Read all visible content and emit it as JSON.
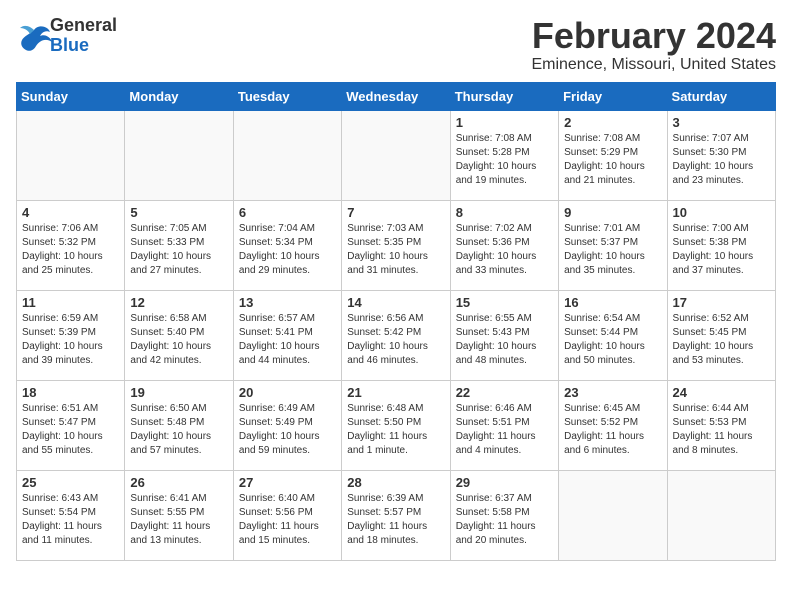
{
  "header": {
    "logo_general": "General",
    "logo_blue": "Blue",
    "month_title": "February 2024",
    "location": "Eminence, Missouri, United States"
  },
  "days_of_week": [
    "Sunday",
    "Monday",
    "Tuesday",
    "Wednesday",
    "Thursday",
    "Friday",
    "Saturday"
  ],
  "weeks": [
    [
      {
        "day": "",
        "info": ""
      },
      {
        "day": "",
        "info": ""
      },
      {
        "day": "",
        "info": ""
      },
      {
        "day": "",
        "info": ""
      },
      {
        "day": "1",
        "info": "Sunrise: 7:08 AM\nSunset: 5:28 PM\nDaylight: 10 hours\nand 19 minutes."
      },
      {
        "day": "2",
        "info": "Sunrise: 7:08 AM\nSunset: 5:29 PM\nDaylight: 10 hours\nand 21 minutes."
      },
      {
        "day": "3",
        "info": "Sunrise: 7:07 AM\nSunset: 5:30 PM\nDaylight: 10 hours\nand 23 minutes."
      }
    ],
    [
      {
        "day": "4",
        "info": "Sunrise: 7:06 AM\nSunset: 5:32 PM\nDaylight: 10 hours\nand 25 minutes."
      },
      {
        "day": "5",
        "info": "Sunrise: 7:05 AM\nSunset: 5:33 PM\nDaylight: 10 hours\nand 27 minutes."
      },
      {
        "day": "6",
        "info": "Sunrise: 7:04 AM\nSunset: 5:34 PM\nDaylight: 10 hours\nand 29 minutes."
      },
      {
        "day": "7",
        "info": "Sunrise: 7:03 AM\nSunset: 5:35 PM\nDaylight: 10 hours\nand 31 minutes."
      },
      {
        "day": "8",
        "info": "Sunrise: 7:02 AM\nSunset: 5:36 PM\nDaylight: 10 hours\nand 33 minutes."
      },
      {
        "day": "9",
        "info": "Sunrise: 7:01 AM\nSunset: 5:37 PM\nDaylight: 10 hours\nand 35 minutes."
      },
      {
        "day": "10",
        "info": "Sunrise: 7:00 AM\nSunset: 5:38 PM\nDaylight: 10 hours\nand 37 minutes."
      }
    ],
    [
      {
        "day": "11",
        "info": "Sunrise: 6:59 AM\nSunset: 5:39 PM\nDaylight: 10 hours\nand 39 minutes."
      },
      {
        "day": "12",
        "info": "Sunrise: 6:58 AM\nSunset: 5:40 PM\nDaylight: 10 hours\nand 42 minutes."
      },
      {
        "day": "13",
        "info": "Sunrise: 6:57 AM\nSunset: 5:41 PM\nDaylight: 10 hours\nand 44 minutes."
      },
      {
        "day": "14",
        "info": "Sunrise: 6:56 AM\nSunset: 5:42 PM\nDaylight: 10 hours\nand 46 minutes."
      },
      {
        "day": "15",
        "info": "Sunrise: 6:55 AM\nSunset: 5:43 PM\nDaylight: 10 hours\nand 48 minutes."
      },
      {
        "day": "16",
        "info": "Sunrise: 6:54 AM\nSunset: 5:44 PM\nDaylight: 10 hours\nand 50 minutes."
      },
      {
        "day": "17",
        "info": "Sunrise: 6:52 AM\nSunset: 5:45 PM\nDaylight: 10 hours\nand 53 minutes."
      }
    ],
    [
      {
        "day": "18",
        "info": "Sunrise: 6:51 AM\nSunset: 5:47 PM\nDaylight: 10 hours\nand 55 minutes."
      },
      {
        "day": "19",
        "info": "Sunrise: 6:50 AM\nSunset: 5:48 PM\nDaylight: 10 hours\nand 57 minutes."
      },
      {
        "day": "20",
        "info": "Sunrise: 6:49 AM\nSunset: 5:49 PM\nDaylight: 10 hours\nand 59 minutes."
      },
      {
        "day": "21",
        "info": "Sunrise: 6:48 AM\nSunset: 5:50 PM\nDaylight: 11 hours\nand 1 minute."
      },
      {
        "day": "22",
        "info": "Sunrise: 6:46 AM\nSunset: 5:51 PM\nDaylight: 11 hours\nand 4 minutes."
      },
      {
        "day": "23",
        "info": "Sunrise: 6:45 AM\nSunset: 5:52 PM\nDaylight: 11 hours\nand 6 minutes."
      },
      {
        "day": "24",
        "info": "Sunrise: 6:44 AM\nSunset: 5:53 PM\nDaylight: 11 hours\nand 8 minutes."
      }
    ],
    [
      {
        "day": "25",
        "info": "Sunrise: 6:43 AM\nSunset: 5:54 PM\nDaylight: 11 hours\nand 11 minutes."
      },
      {
        "day": "26",
        "info": "Sunrise: 6:41 AM\nSunset: 5:55 PM\nDaylight: 11 hours\nand 13 minutes."
      },
      {
        "day": "27",
        "info": "Sunrise: 6:40 AM\nSunset: 5:56 PM\nDaylight: 11 hours\nand 15 minutes."
      },
      {
        "day": "28",
        "info": "Sunrise: 6:39 AM\nSunset: 5:57 PM\nDaylight: 11 hours\nand 18 minutes."
      },
      {
        "day": "29",
        "info": "Sunrise: 6:37 AM\nSunset: 5:58 PM\nDaylight: 11 hours\nand 20 minutes."
      },
      {
        "day": "",
        "info": ""
      },
      {
        "day": "",
        "info": ""
      }
    ]
  ]
}
